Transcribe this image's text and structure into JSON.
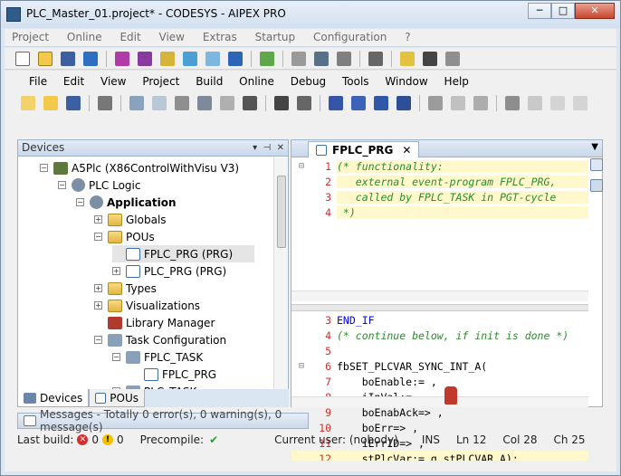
{
  "window": {
    "title": "PLC_Master_01.project* - CODESYS  -  AIPEX PRO",
    "buttons": [
      "─",
      "□",
      "✕"
    ]
  },
  "outer_menu": [
    "Project",
    "Online",
    "Edit",
    "View",
    "Extras",
    "Startup",
    "Configuration",
    "?"
  ],
  "inner_menu": [
    "File",
    "Edit",
    "View",
    "Project",
    "Build",
    "Online",
    "Debug",
    "Tools",
    "Window",
    "Help"
  ],
  "devices_panel": {
    "title": "Devices",
    "tree": [
      {
        "label": "A5Plc (X86ControlWithVisu V3)",
        "indent": 0,
        "exp": "−",
        "icon": "plc-icon"
      },
      {
        "label": "PLC Logic",
        "indent": 1,
        "exp": "−",
        "icon": "gear-icon"
      },
      {
        "label": "Application",
        "indent": 2,
        "exp": "−",
        "icon": "gear-icon",
        "bold": true
      },
      {
        "label": "Globals",
        "indent": 3,
        "exp": "+",
        "icon": "folder-icon"
      },
      {
        "label": "POUs",
        "indent": 3,
        "exp": "−",
        "icon": "folder-icon"
      },
      {
        "label": "FPLC_PRG (PRG)",
        "indent": 4,
        "exp": "",
        "icon": "doc-icon",
        "selected": true
      },
      {
        "label": "PLC_PRG (PRG)",
        "indent": 4,
        "exp": "+",
        "icon": "doc-icon"
      },
      {
        "label": "Types",
        "indent": 3,
        "exp": "+",
        "icon": "folder-icon"
      },
      {
        "label": "Visualizations",
        "indent": 3,
        "exp": "+",
        "icon": "folder-icon"
      },
      {
        "label": "Library Manager",
        "indent": 3,
        "exp": "",
        "icon": "library-icon"
      },
      {
        "label": "Task Configuration",
        "indent": 3,
        "exp": "−",
        "icon": "task-config-icon"
      },
      {
        "label": "FPLC_TASK",
        "indent": 4,
        "exp": "−",
        "icon": "task-icon"
      },
      {
        "label": "FPLC_PRG",
        "indent": 5,
        "exp": "",
        "icon": "doc-icon"
      },
      {
        "label": "PLC_TASK",
        "indent": 4,
        "exp": "−",
        "icon": "task-icon"
      }
    ],
    "tabs": [
      "Devices",
      "POUs"
    ]
  },
  "editor": {
    "tab_title": "FPLC_PRG",
    "top_lines": [
      {
        "n": "1",
        "text": "(* functionality:",
        "type": "comment",
        "fold": "−"
      },
      {
        "n": "2",
        "text": "   external event-program FPLC_PRG,",
        "type": "comment",
        "fold": ""
      },
      {
        "n": "3",
        "text": "   called by FPLC_TASK in PGT-cycle",
        "type": "comment",
        "fold": ""
      },
      {
        "n": "4",
        "text": " *)",
        "type": "comment",
        "fold": ""
      }
    ],
    "bottom_lines": [
      {
        "n": "3",
        "text": "END_IF",
        "type": "keyword",
        "fold": ""
      },
      {
        "n": "4",
        "text": "(* continue below, if init is done *)",
        "type": "comment",
        "fold": ""
      },
      {
        "n": "5",
        "text": "",
        "type": "plain",
        "fold": ""
      },
      {
        "n": "6",
        "text": "fbSET_PLCVAR_SYNC_INT_A(",
        "type": "plain",
        "fold": "−"
      },
      {
        "n": "7",
        "text": "    boEnable:= ,",
        "type": "plain",
        "fold": ""
      },
      {
        "n": "8",
        "text": "    iInVal:= ,",
        "type": "plain",
        "fold": ""
      },
      {
        "n": "9",
        "text": "    boEnabAck=> ,",
        "type": "plain",
        "fold": ""
      },
      {
        "n": "10",
        "text": "    boErr=> ,",
        "type": "plain",
        "fold": ""
      },
      {
        "n": "11",
        "text": "    iErrID=> ,",
        "type": "plain",
        "fold": ""
      },
      {
        "n": "12",
        "text": "    stPlcVar:= g_stPLCVAR_A);",
        "type": "plain",
        "fold": "",
        "current": true
      }
    ]
  },
  "messages": "Messages - Totally 0 error(s), 0 warning(s), 0 message(s)",
  "status": {
    "last_build_label": "Last build:",
    "errors": "0",
    "warnings": "0",
    "precompile_label": "Precompile:",
    "current_user": "Current user: (nobody)",
    "mode": "INS",
    "line": "Ln 12",
    "col": "Col 28",
    "ch": "Ch 25"
  },
  "colors": {
    "keyword": "#0000ff",
    "comment": "#2c8c2c",
    "line_number": "#cf2f2f",
    "current_line": "#fff8cc",
    "accent": "#2f5d8a"
  }
}
